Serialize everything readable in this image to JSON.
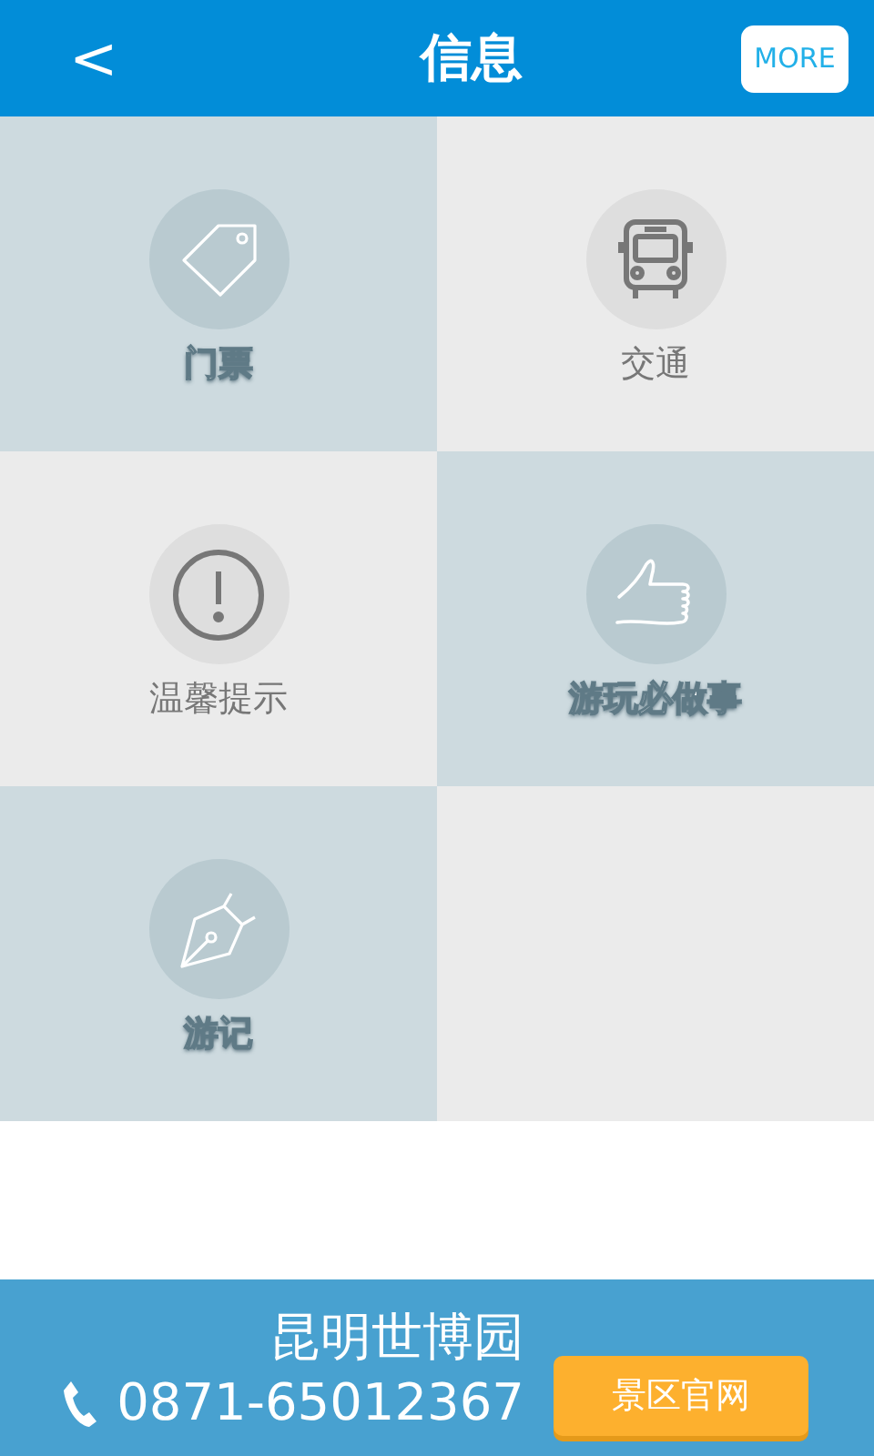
{
  "header": {
    "back": "<",
    "title": "信息",
    "more": "MORE"
  },
  "tiles": [
    {
      "kind": "ticket",
      "label": "门票",
      "color": "#cddadf"
    },
    {
      "kind": "bus",
      "label": "交通",
      "color": "#ebebeb"
    },
    {
      "kind": "alert",
      "label": "温馨提示",
      "color": "#ebebeb"
    },
    {
      "kind": "thumb",
      "label": "游玩必做事",
      "color": "#cddadf"
    },
    {
      "kind": "pen",
      "label": "游记",
      "color": "#cddadf"
    },
    {
      "kind": "empty",
      "color": "#ebebeb"
    }
  ],
  "footer": {
    "name": "昆明世博园",
    "phone": "0871-65012367",
    "button": "景区官网"
  }
}
